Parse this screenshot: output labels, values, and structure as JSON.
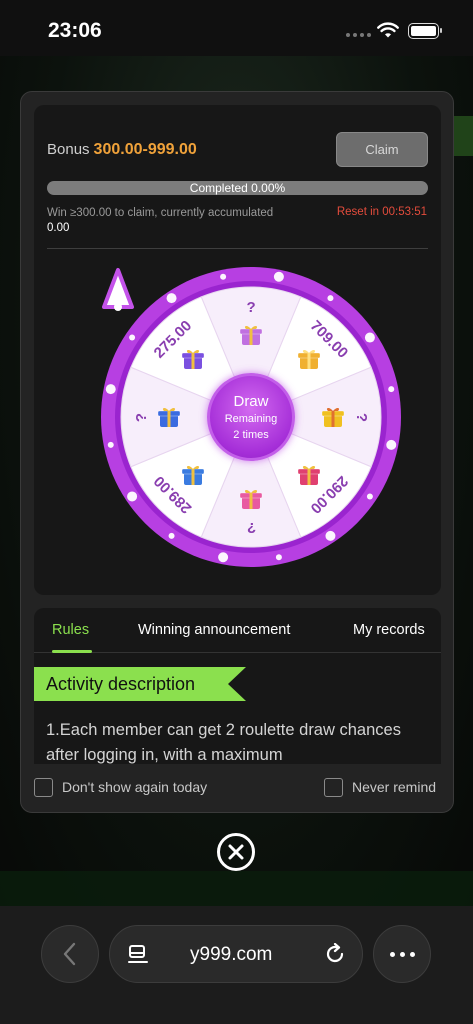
{
  "status": {
    "time": "23:06"
  },
  "bonus": {
    "label": "Bonus",
    "range": "300.00-999.00",
    "claim_label": "Claim",
    "progress_text": "Completed 0.00%",
    "progress_fraction": 0,
    "win_text": "Win ≥300.00 to claim, currently accumulated",
    "accumulated": "0.00",
    "reset_text": "Reset in 00:53:51"
  },
  "wheel": {
    "segments": [
      "?",
      "709.00",
      "?",
      "290.00",
      "?",
      "289.00",
      "?",
      "275.00"
    ],
    "draw_label": "Draw",
    "remaining_label": "Remaining",
    "remaining_times": "2 times"
  },
  "tabs": [
    {
      "label": "Rules",
      "active": true
    },
    {
      "label": "Winning announcement",
      "active": false
    },
    {
      "label": "My records",
      "active": false
    }
  ],
  "rules": {
    "heading": "Activity description",
    "text": "1.Each member can get 2 roulette draw chances after logging in, with a maximum"
  },
  "options": {
    "dont_show": "Don't show again today",
    "never_remind": "Never remind"
  },
  "browser": {
    "url": "y999.com"
  },
  "colors": {
    "accent_green": "#8be04e",
    "bonus_orange": "#f0a23a",
    "wheel_purple": "#b23fe0",
    "reset_red": "#e34c3c"
  }
}
